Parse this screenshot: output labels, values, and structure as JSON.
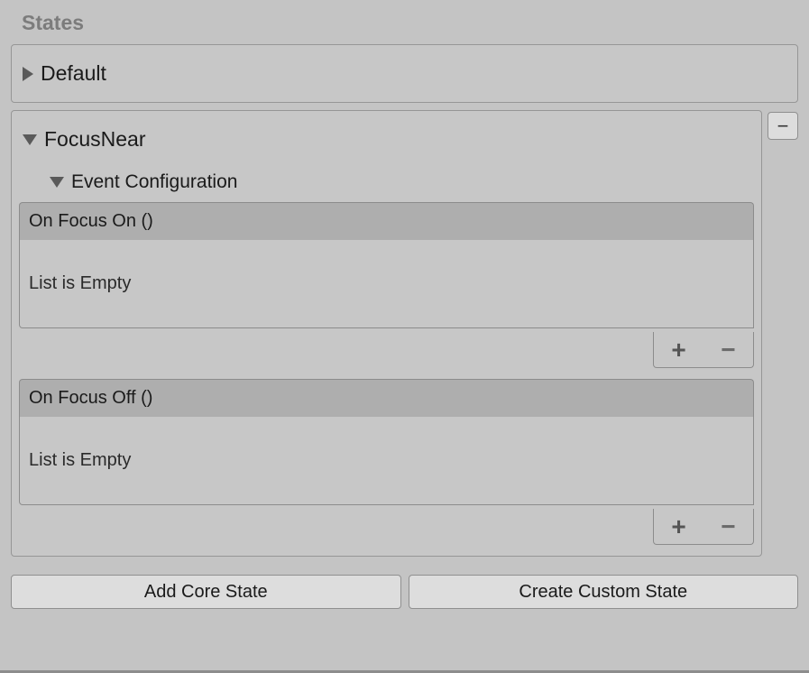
{
  "section_title": "States",
  "states": {
    "default": {
      "name": "Default"
    },
    "focus_near": {
      "name": "FocusNear",
      "remove_label": "−",
      "event_config_title": "Event Configuration",
      "events": {
        "on_focus_on": {
          "title": "On Focus On ()",
          "empty_text": "List is Empty",
          "plus": "+",
          "minus": "−"
        },
        "on_focus_off": {
          "title": "On Focus Off ()",
          "empty_text": "List is Empty",
          "plus": "+",
          "minus": "−"
        }
      }
    }
  },
  "buttons": {
    "add_core_state": "Add Core State",
    "create_custom_state": "Create Custom State"
  }
}
